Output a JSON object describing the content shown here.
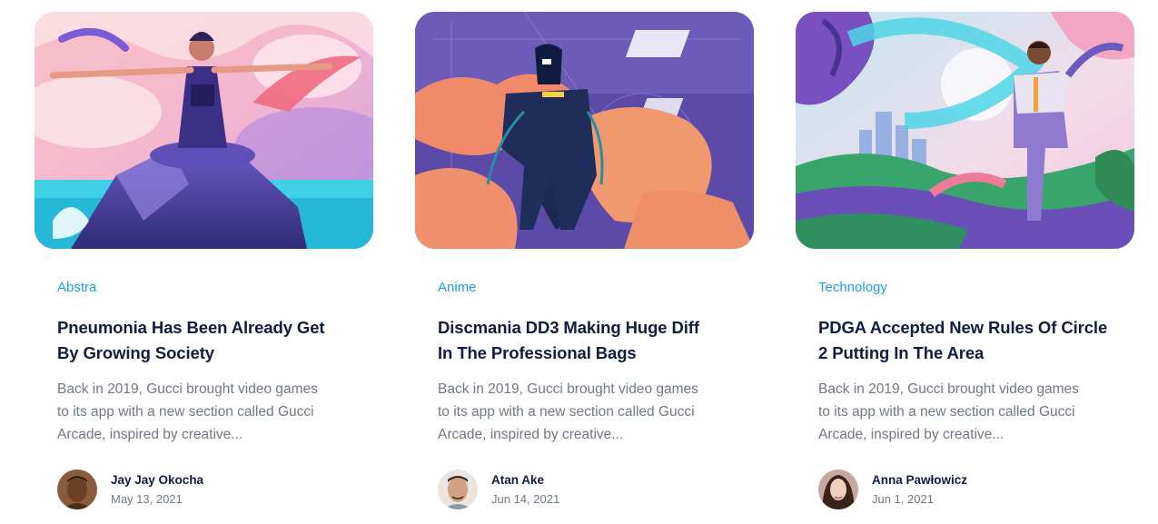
{
  "posts": [
    {
      "category": "Abstra",
      "title_line1": "Pneumonia Has Been Already Get",
      "title_line2": "By Growing Society",
      "excerpt_line1": "Back in 2019, Gucci brought video games",
      "excerpt_line2": "to its app with a new section called Gucci",
      "excerpt_line3": "Arcade, inspired by creative...",
      "author": "Jay Jay Okocha",
      "date": "May 13, 2021"
    },
    {
      "category": "Anime",
      "title_line1": "Discmania DD3 Making Huge Diff",
      "title_line2": "In The Professional Bags",
      "excerpt_line1": "Back in 2019, Gucci brought video games",
      "excerpt_line2": "to its app with a new section called Gucci",
      "excerpt_line3": "Arcade, inspired by creative...",
      "author": "Atan Ake",
      "date": "Jun 14, 2021"
    },
    {
      "category": "Technology",
      "title_line1": "PDGA Accepted New Rules Of Circle",
      "title_line2": "2 Putting In The Area",
      "excerpt_line1": "Back in 2019, Gucci brought video games",
      "excerpt_line2": "to its app with a new section called Gucci",
      "excerpt_line3": "Arcade, inspired by creative...",
      "author": "Anna Pawłowicz",
      "date": "Jun 1, 2021"
    }
  ],
  "colors": {
    "accent": "#1ca0ea",
    "heading": "#111c3f",
    "muted": "#707787"
  }
}
